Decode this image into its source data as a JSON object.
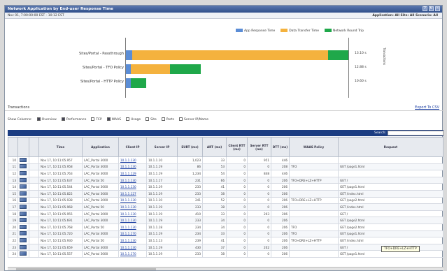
{
  "window": {
    "title": "Network Application by End-user Response Time",
    "btn_a": "?",
    "btn_b": "↻",
    "btn_c": "✕"
  },
  "subbar": {
    "left": "Nov 01, 7:00:00:00 EST - 10:12 EST",
    "right": "Application: All  Site: All  Scenario: All"
  },
  "chart_data": {
    "type": "bar",
    "orientation": "horizontal",
    "stacked": true,
    "categories": [
      "Sites/Portal - Passthrough",
      "Sites/Portal - TFO Policy",
      "Sites/Portal - HTTP Policy"
    ],
    "series": [
      {
        "name": "App Response Time",
        "color": "#5b8dd6",
        "values": [
          0.4,
          0.3,
          0.3
        ]
      },
      {
        "name": "Data Transfer Time",
        "color": "#f4b23e",
        "values": [
          12.5,
          2.5,
          0
        ]
      },
      {
        "name": "Network Round Trip",
        "color": "#1fa84a",
        "values": [
          1.3,
          2.0,
          1.0
        ]
      }
    ],
    "right_labels": [
      "13.10 s",
      "12.88 s",
      "10.60 s"
    ],
    "right_axis": "Transactions"
  },
  "txtitle": "Transactions",
  "export": "Export To CSV",
  "show_columns": {
    "label": "Show Columns:",
    "items": [
      {
        "label": "Overview",
        "on": true
      },
      {
        "label": "Performance",
        "on": true
      },
      {
        "label": "TCP",
        "on": false
      },
      {
        "label": "WAAS",
        "on": true
      },
      {
        "label": "Usage",
        "on": false
      },
      {
        "label": "Site",
        "on": false
      },
      {
        "label": "Ports",
        "on": false
      },
      {
        "label": "Server IP/Name",
        "on": false
      }
    ]
  },
  "search": {
    "label": "Search:"
  },
  "columns": [
    "",
    "",
    "",
    "Time",
    "Application",
    "Client IP",
    "Server IP",
    "EURT (ms)",
    "ART (ms)",
    "Client RTT (ms)",
    "Server RTT (ms)",
    "DTT (ms)",
    "WAAS Policy",
    "Request"
  ],
  "rows": [
    [
      "10",
      "Nov 17, 10:11:05.957",
      "LAC_Portal 3000",
      "10.1.1.130",
      "10.1.1.10",
      "1,023",
      "33",
      "0",
      "951",
      "446",
      "",
      ""
    ],
    [
      "11",
      "Nov 17, 10:11:05.958",
      "LAC_Portal 3000",
      "10.1.1.130",
      "10.1.1.19",
      "86",
      "53",
      "0",
      "0",
      "208",
      "TFO",
      "GET /page1.html"
    ],
    [
      "12",
      "Nov 17, 10:11:05.763",
      "LAC_Portal 3000",
      "10.1.1.129",
      "10.1.1.19",
      "1,234",
      "54",
      "0",
      "848",
      "446",
      "",
      ""
    ],
    [
      "13",
      "Nov 17, 10:11:05.637",
      "LAC_Portal 50",
      "10.1.1.130",
      "10.1.1.17",
      "231",
      "66",
      "0",
      "0",
      "206",
      "TFO+DRE+LZ+HTTP",
      "GET /"
    ],
    [
      "14",
      "Nov 17, 10:11:05.544",
      "LAC_Portal 3000",
      "10.1.1.130",
      "10.1.1.19",
      "233",
      "41",
      "0",
      "0",
      "206",
      "",
      "GET /page1.html"
    ],
    [
      "15",
      "Nov 17, 10:11:05.822",
      "LAC_Portal 3000",
      "10.1.1.127",
      "10.1.1.19",
      "233",
      "38",
      "0",
      "0",
      "206",
      "",
      "GET /index.html"
    ],
    [
      "16",
      "Nov 17, 10:11:05.938",
      "LAC_Portal 3000",
      "10.1.1.130",
      "10.1.1.10",
      "241",
      "52",
      "0",
      "0",
      "206",
      "TFO+DRE+LZ+HTTP",
      "GET /page2.html"
    ],
    [
      "17",
      "Nov 17, 10:11:05.968",
      "LAC_Portal 50",
      "10.1.1.130",
      "10.1.1.19",
      "233",
      "38",
      "0",
      "0",
      "206",
      "",
      "GET /index.html"
    ],
    [
      "18",
      "Nov 17, 10:11:05.955",
      "LAC_Portal 3000",
      "10.1.1.130",
      "10.1.1.19",
      "410",
      "33",
      "0",
      "203",
      "206",
      "",
      "GET /"
    ],
    [
      "19",
      "Nov 17, 10:11:05.691",
      "LAC_Portal 3000",
      "10.1.1.130",
      "10.1.1.19",
      "233",
      "34",
      "0",
      "0",
      "206",
      "",
      "GET /page2.html"
    ],
    [
      "20",
      "Nov 17, 10:11:05.768",
      "LAC_Portal 50",
      "10.1.1.130",
      "10.1.1.18",
      "234",
      "34",
      "0",
      "0",
      "206",
      "TFO",
      "GET /page2.html"
    ],
    [
      "21",
      "Nov 17, 10:11:05.720",
      "LAC_Portal 3000",
      "10.1.1.170",
      "10.1.1.19",
      "234",
      "33",
      "0",
      "0",
      "206",
      "TFO",
      "GET /page1.html"
    ],
    [
      "22",
      "Nov 17, 10:11:05.930",
      "LAC_Portal 50",
      "10.1.1.130",
      "10.1.1.13",
      "239",
      "41",
      "0",
      "0",
      "206",
      "TFO+DRE+LZ+HTTP",
      "GET /index.html"
    ],
    [
      "23",
      "Nov 17, 10:11:05.659",
      "LAC_Portal 3000",
      "10.1.1.130",
      "10.1.1.19",
      "430",
      "37",
      "0",
      "202",
      "206",
      "",
      "GET /"
    ],
    [
      "24",
      "Nov 17, 10:11:05.557",
      "LAC_Portal 3000",
      "10.1.1.170",
      "10.1.1.19",
      "233",
      "38",
      "0",
      "0",
      "206",
      "",
      "GET /page1.html"
    ]
  ],
  "tooltip": "TFO+DRE+LZ+HTTP"
}
